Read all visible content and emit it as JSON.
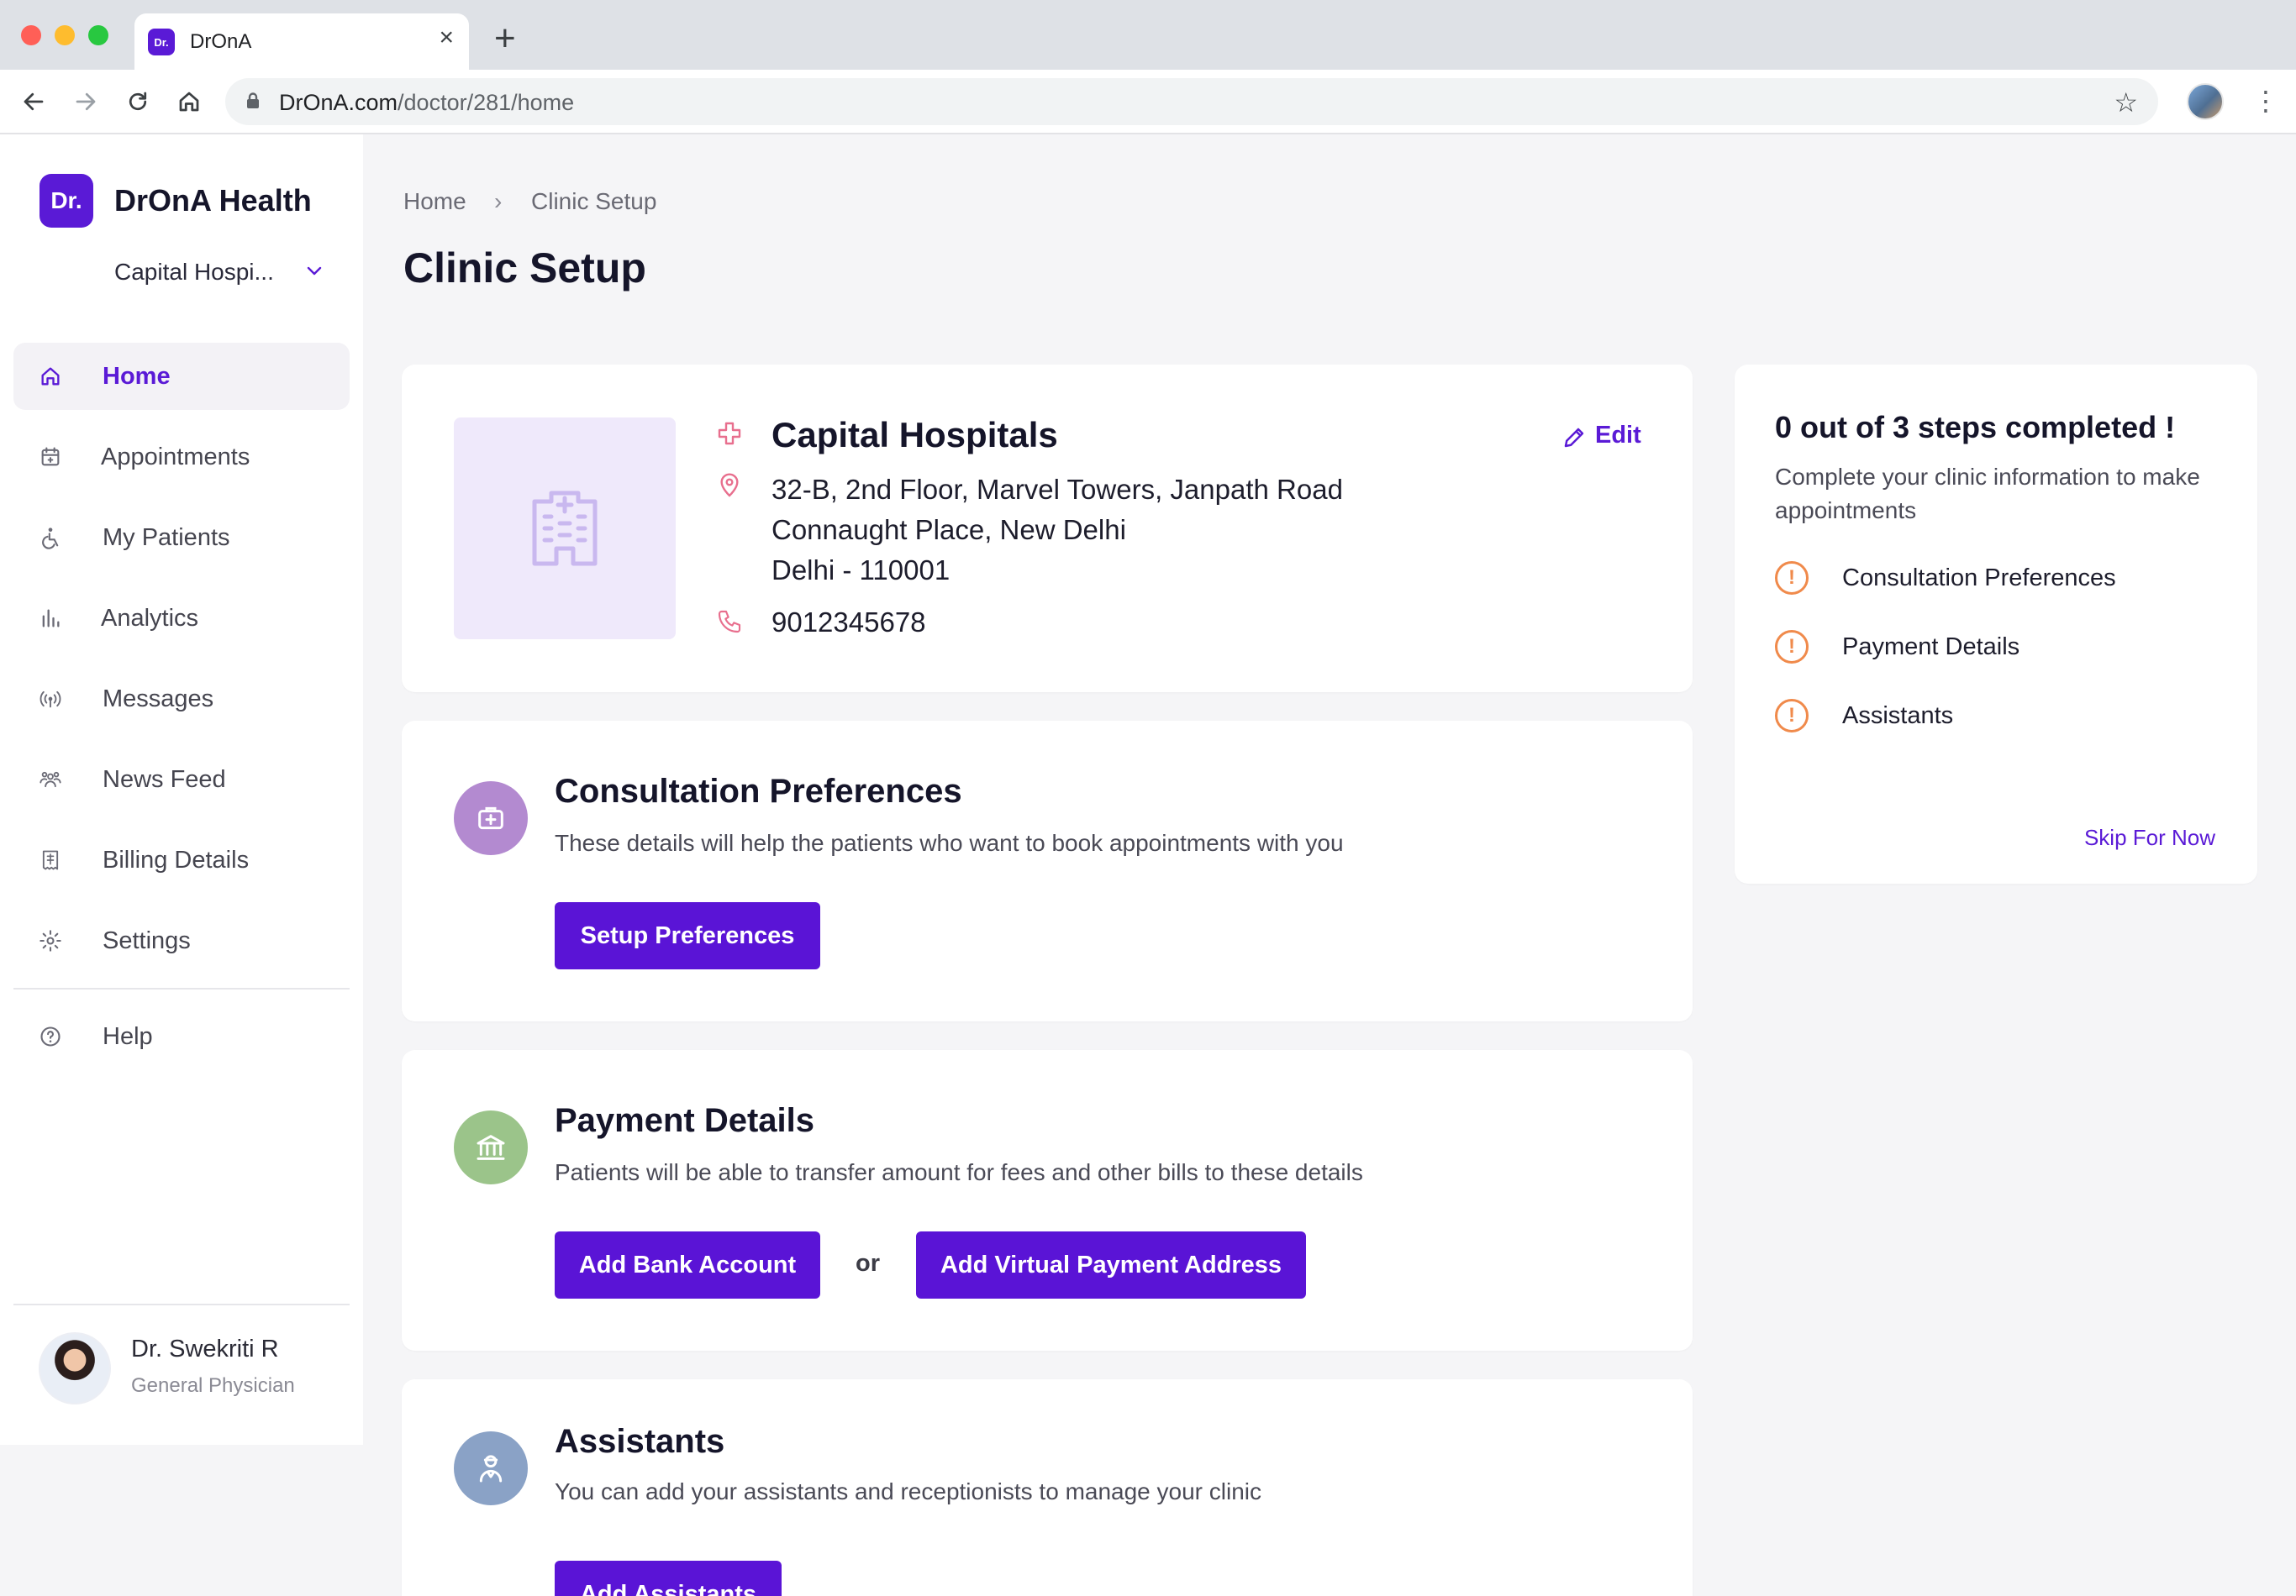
{
  "browser": {
    "tab_title": "DrOnA",
    "favicon_text": "Dr.",
    "url_host": "DrOnA.com",
    "url_path": "/doctor/281/home"
  },
  "sidebar": {
    "logo_text": "Dr.",
    "brand": "DrOnA Health",
    "clinic_selector": "Capital Hospi...",
    "items": [
      {
        "label": "Home",
        "icon": "home-icon"
      },
      {
        "label": "Appointments",
        "icon": "calendar-icon"
      },
      {
        "label": "My Patients",
        "icon": "patient-icon"
      },
      {
        "label": "Analytics",
        "icon": "bar-chart-icon"
      },
      {
        "label": "Messages",
        "icon": "broadcast-icon"
      },
      {
        "label": "News Feed",
        "icon": "group-icon"
      },
      {
        "label": "Billing Details",
        "icon": "receipt-icon"
      },
      {
        "label": "Settings",
        "icon": "gear-icon"
      },
      {
        "label": "Help",
        "icon": "help-icon"
      }
    ],
    "user": {
      "name": "Dr. Swekriti R",
      "role": "General Physician"
    }
  },
  "breadcrumb": {
    "home": "Home",
    "separator": "›",
    "current": "Clinic Setup"
  },
  "page_title": "Clinic Setup",
  "clinic": {
    "name": "Capital Hospitals",
    "address_lines": [
      "32-B, 2nd Floor, Marvel Towers, Janpath Road",
      "Connaught Place, New Delhi",
      "Delhi - 110001"
    ],
    "phone": "9012345678",
    "edit_label": "Edit"
  },
  "sections": {
    "consultation": {
      "title": "Consultation Preferences",
      "desc": "These details will help the patients who want to book appointments with you",
      "button": "Setup Preferences",
      "icon_color": "#b38ad0"
    },
    "payment": {
      "title": "Payment Details",
      "desc": "Patients will be able to transfer amount for fees and other bills to these details",
      "button_bank": "Add Bank Account",
      "or": "or",
      "button_vpa": "Add Virtual Payment Address",
      "icon_color": "#9bc48a"
    },
    "assistants": {
      "title": "Assistants",
      "desc": "You can add your assistants and receptionists to manage your clinic",
      "button": "Add Assistants",
      "icon_color": "#8aa2c6"
    }
  },
  "steps": {
    "title": "0 out of 3 steps completed !",
    "subtitle": "Complete your clinic information to make appointments",
    "items": [
      "Consultation Preferences",
      "Payment Details",
      "Assistants"
    ],
    "warn_glyph": "!",
    "skip": "Skip For Now"
  },
  "colors": {
    "accent": "#5a14d6",
    "warning": "#f08a4b",
    "clinic_icon_pink": "#e86f8e"
  }
}
